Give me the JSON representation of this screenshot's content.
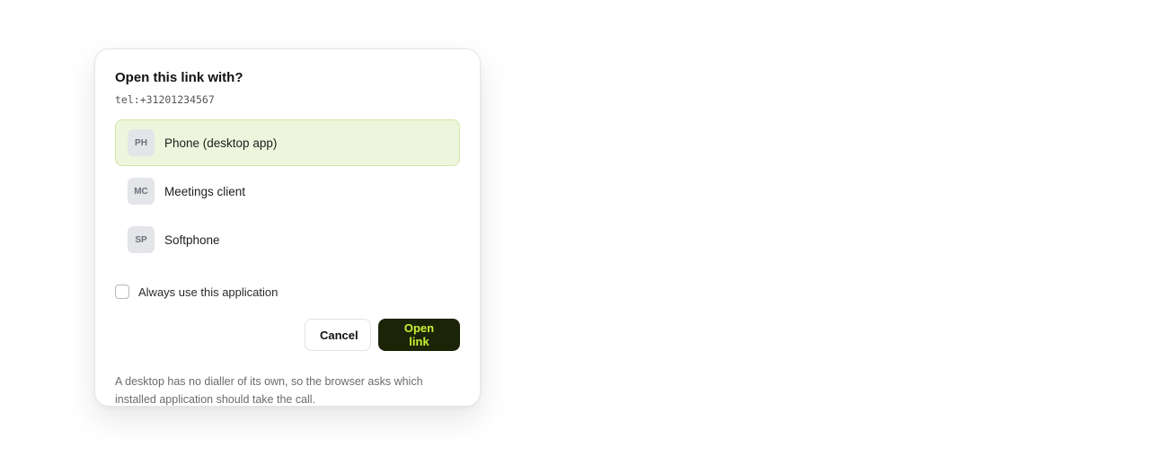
{
  "dialog": {
    "title": "Open this link with?",
    "url": "tel:+31201234567",
    "apps": [
      {
        "badge": "PH",
        "label": "Phone (desktop app)",
        "selected": true
      },
      {
        "badge": "MC",
        "label": "Meetings client",
        "selected": false
      },
      {
        "badge": "SP",
        "label": "Softphone",
        "selected": false
      }
    ],
    "always_use_label": "Always use this application",
    "always_use_checked": false,
    "cancel_label": "Cancel",
    "open_label": "Open link",
    "footnote": "A desktop has no dialler of its own, so the browser asks which installed application should take the call."
  },
  "colors": {
    "selected_bg": "#eef5dd",
    "selected_border": "#d2e7a8",
    "primary_button_bg": "#1c2407",
    "primary_button_text": "#c6f135"
  }
}
